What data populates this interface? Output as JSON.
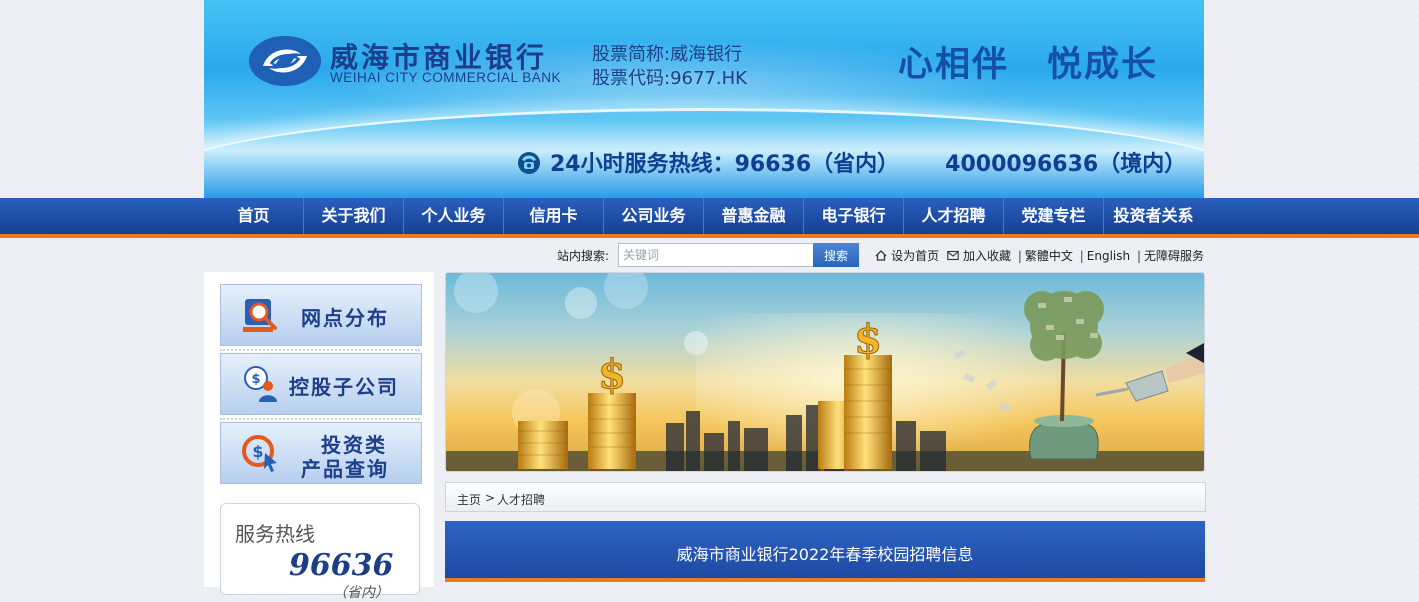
{
  "header": {
    "bank_name_cn": "威海市商业银行",
    "bank_name_en": "WEIHAI CITY COMMERCIAL BANK",
    "stock_name": "股票简称:威海银行",
    "stock_code": "股票代码:9677.HK",
    "slogan_1": "心相伴",
    "slogan_2": "悦成长",
    "hotline_domestic": "24小时服务热线：96636（省内）",
    "hotline_international": "4000096636（境内）"
  },
  "nav": {
    "items": [
      {
        "label": "首页"
      },
      {
        "label": "关于我们"
      },
      {
        "label": "个人业务"
      },
      {
        "label": "信用卡"
      },
      {
        "label": "公司业务"
      },
      {
        "label": "普惠金融"
      },
      {
        "label": "电子银行"
      },
      {
        "label": "人才招聘"
      },
      {
        "label": "党建专栏"
      },
      {
        "label": "投资者关系"
      }
    ]
  },
  "search": {
    "label": "站内搜索:",
    "placeholder": "关键词",
    "button_label": "搜索"
  },
  "util_links": {
    "set_home": "设为首页",
    "add_favorite": "加入收藏",
    "traditional": "繁體中文",
    "english": "English",
    "accessibility": "无障碍服务",
    "separator": "|"
  },
  "sidebar": {
    "buttons": [
      {
        "label": "网点分布"
      },
      {
        "label": "控股子公司"
      },
      {
        "label_line1": "投资类",
        "label_line2": "产品查询"
      }
    ],
    "hotline_title": "服务热线",
    "hotline_number": "96636",
    "hotline_sub": "（省内）"
  },
  "breadcrumb": {
    "home": "主页",
    "arrow": ">",
    "current": "人才招聘"
  },
  "article": {
    "title": "威海市商业银行2022年春季校园招聘信息"
  },
  "colors": {
    "nav_blue": "#1e4ea6",
    "accent_orange": "#e97a1f",
    "brand_dark_blue": "#1a3e8c"
  }
}
